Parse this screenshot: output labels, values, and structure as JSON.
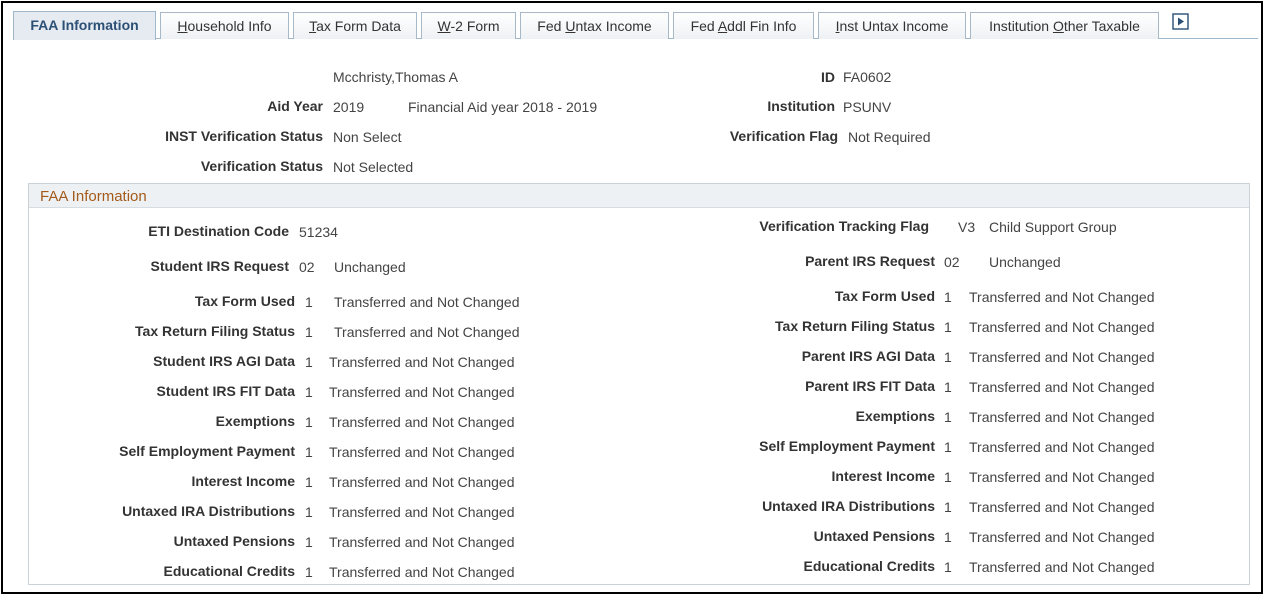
{
  "tabs": [
    {
      "label": "FAA Information",
      "active": true
    },
    {
      "label": "Household Info",
      "underline": "H"
    },
    {
      "label": "Tax Form Data",
      "underline": "T"
    },
    {
      "label": "W-2 Form",
      "underline": "W"
    },
    {
      "label": "Fed Untax Income",
      "underline": "U"
    },
    {
      "label": "Fed Addl Fin Info",
      "underline": "A"
    },
    {
      "label": "Inst Untax Income",
      "underline": "I"
    },
    {
      "label": "Institution Other Taxable",
      "underline": "O"
    }
  ],
  "header": {
    "name": "Mcchristy,Thomas A",
    "id_label": "ID",
    "id_value": "FA0602",
    "aid_year_label": "Aid Year",
    "aid_year_value": "2019",
    "aid_year_desc": "Financial Aid year 2018 - 2019",
    "institution_label": "Institution",
    "institution_value": "PSUNV",
    "inst_verif_label": "INST Verification Status",
    "inst_verif_value": "Non Select",
    "verif_flag_label": "Verification Flag",
    "verif_flag_value": "Not Required",
    "verif_status_label": "Verification Status",
    "verif_status_value": "Not Selected"
  },
  "section": {
    "title": "FAA Information",
    "eti_label": "ETI Destination Code",
    "eti_value": "51234",
    "vtf_label": "Verification Tracking Flag",
    "vtf_code": "V3",
    "vtf_desc": "Child Support Group",
    "student_irs_label": "Student IRS Request",
    "student_irs_code": "02",
    "student_irs_desc": "Unchanged",
    "parent_irs_label": "Parent IRS Request",
    "parent_irs_code": "02",
    "parent_irs_desc": "Unchanged",
    "left_rows": [
      {
        "label": "Tax Form Used",
        "code": "1",
        "desc": "Transferred and Not Changed"
      },
      {
        "label": "Tax Return Filing Status",
        "code": "1",
        "desc": "Transferred and Not Changed"
      },
      {
        "label": "Student IRS AGI Data",
        "code": "1",
        "desc": "Transferred and Not Changed"
      },
      {
        "label": "Student IRS FIT Data",
        "code": "1",
        "desc": "Transferred and Not Changed"
      },
      {
        "label": "Exemptions",
        "code": "1",
        "desc": "Transferred and Not Changed"
      },
      {
        "label": "Self Employment Payment",
        "code": "1",
        "desc": "Transferred and Not Changed"
      },
      {
        "label": "Interest Income",
        "code": "1",
        "desc": "Transferred and Not Changed"
      },
      {
        "label": "Untaxed IRA Distributions",
        "code": "1",
        "desc": "Transferred and Not Changed"
      },
      {
        "label": "Untaxed Pensions",
        "code": "1",
        "desc": "Transferred and Not Changed"
      },
      {
        "label": "Educational Credits",
        "code": "1",
        "desc": "Transferred and Not Changed"
      }
    ],
    "right_rows": [
      {
        "label": "Tax Form Used",
        "code": "1",
        "desc": "Transferred and Not Changed"
      },
      {
        "label": "Tax Return Filing Status",
        "code": "1",
        "desc": "Transferred and Not Changed"
      },
      {
        "label": "Parent IRS AGI Data",
        "code": "1",
        "desc": "Transferred and Not Changed"
      },
      {
        "label": "Parent IRS FIT Data",
        "code": "1",
        "desc": "Transferred and Not Changed"
      },
      {
        "label": "Exemptions",
        "code": "1",
        "desc": "Transferred and Not Changed"
      },
      {
        "label": "Self Employment Payment",
        "code": "1",
        "desc": "Transferred and Not Changed"
      },
      {
        "label": "Interest Income",
        "code": "1",
        "desc": "Transferred and Not Changed"
      },
      {
        "label": "Untaxed IRA Distributions",
        "code": "1",
        "desc": "Transferred and Not Changed"
      },
      {
        "label": "Untaxed Pensions",
        "code": "1",
        "desc": "Transferred and Not Changed"
      },
      {
        "label": "Educational Credits",
        "code": "1",
        "desc": "Transferred and Not Changed"
      }
    ]
  },
  "icons": {
    "next_tabs": "play-right-icon"
  },
  "colors": {
    "active_tab_text": "#2c4f75",
    "section_title": "#a35a1a",
    "tab_border": "#9fb7ca"
  }
}
